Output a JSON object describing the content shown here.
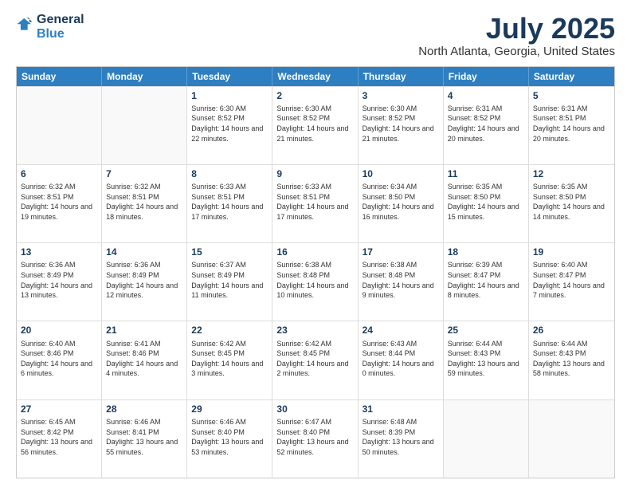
{
  "header": {
    "logo_general": "General",
    "logo_blue": "Blue",
    "month": "July 2025",
    "location": "North Atlanta, Georgia, United States"
  },
  "days_of_week": [
    "Sunday",
    "Monday",
    "Tuesday",
    "Wednesday",
    "Thursday",
    "Friday",
    "Saturday"
  ],
  "weeks": [
    [
      {
        "day": "",
        "sunrise": "",
        "sunset": "",
        "daylight": "",
        "empty": true
      },
      {
        "day": "",
        "sunrise": "",
        "sunset": "",
        "daylight": "",
        "empty": true
      },
      {
        "day": "1",
        "sunrise": "Sunrise: 6:30 AM",
        "sunset": "Sunset: 8:52 PM",
        "daylight": "Daylight: 14 hours and 22 minutes."
      },
      {
        "day": "2",
        "sunrise": "Sunrise: 6:30 AM",
        "sunset": "Sunset: 8:52 PM",
        "daylight": "Daylight: 14 hours and 21 minutes."
      },
      {
        "day": "3",
        "sunrise": "Sunrise: 6:30 AM",
        "sunset": "Sunset: 8:52 PM",
        "daylight": "Daylight: 14 hours and 21 minutes."
      },
      {
        "day": "4",
        "sunrise": "Sunrise: 6:31 AM",
        "sunset": "Sunset: 8:52 PM",
        "daylight": "Daylight: 14 hours and 20 minutes."
      },
      {
        "day": "5",
        "sunrise": "Sunrise: 6:31 AM",
        "sunset": "Sunset: 8:51 PM",
        "daylight": "Daylight: 14 hours and 20 minutes."
      }
    ],
    [
      {
        "day": "6",
        "sunrise": "Sunrise: 6:32 AM",
        "sunset": "Sunset: 8:51 PM",
        "daylight": "Daylight: 14 hours and 19 minutes."
      },
      {
        "day": "7",
        "sunrise": "Sunrise: 6:32 AM",
        "sunset": "Sunset: 8:51 PM",
        "daylight": "Daylight: 14 hours and 18 minutes."
      },
      {
        "day": "8",
        "sunrise": "Sunrise: 6:33 AM",
        "sunset": "Sunset: 8:51 PM",
        "daylight": "Daylight: 14 hours and 17 minutes."
      },
      {
        "day": "9",
        "sunrise": "Sunrise: 6:33 AM",
        "sunset": "Sunset: 8:51 PM",
        "daylight": "Daylight: 14 hours and 17 minutes."
      },
      {
        "day": "10",
        "sunrise": "Sunrise: 6:34 AM",
        "sunset": "Sunset: 8:50 PM",
        "daylight": "Daylight: 14 hours and 16 minutes."
      },
      {
        "day": "11",
        "sunrise": "Sunrise: 6:35 AM",
        "sunset": "Sunset: 8:50 PM",
        "daylight": "Daylight: 14 hours and 15 minutes."
      },
      {
        "day": "12",
        "sunrise": "Sunrise: 6:35 AM",
        "sunset": "Sunset: 8:50 PM",
        "daylight": "Daylight: 14 hours and 14 minutes."
      }
    ],
    [
      {
        "day": "13",
        "sunrise": "Sunrise: 6:36 AM",
        "sunset": "Sunset: 8:49 PM",
        "daylight": "Daylight: 14 hours and 13 minutes."
      },
      {
        "day": "14",
        "sunrise": "Sunrise: 6:36 AM",
        "sunset": "Sunset: 8:49 PM",
        "daylight": "Daylight: 14 hours and 12 minutes."
      },
      {
        "day": "15",
        "sunrise": "Sunrise: 6:37 AM",
        "sunset": "Sunset: 8:49 PM",
        "daylight": "Daylight: 14 hours and 11 minutes."
      },
      {
        "day": "16",
        "sunrise": "Sunrise: 6:38 AM",
        "sunset": "Sunset: 8:48 PM",
        "daylight": "Daylight: 14 hours and 10 minutes."
      },
      {
        "day": "17",
        "sunrise": "Sunrise: 6:38 AM",
        "sunset": "Sunset: 8:48 PM",
        "daylight": "Daylight: 14 hours and 9 minutes."
      },
      {
        "day": "18",
        "sunrise": "Sunrise: 6:39 AM",
        "sunset": "Sunset: 8:47 PM",
        "daylight": "Daylight: 14 hours and 8 minutes."
      },
      {
        "day": "19",
        "sunrise": "Sunrise: 6:40 AM",
        "sunset": "Sunset: 8:47 PM",
        "daylight": "Daylight: 14 hours and 7 minutes."
      }
    ],
    [
      {
        "day": "20",
        "sunrise": "Sunrise: 6:40 AM",
        "sunset": "Sunset: 8:46 PM",
        "daylight": "Daylight: 14 hours and 6 minutes."
      },
      {
        "day": "21",
        "sunrise": "Sunrise: 6:41 AM",
        "sunset": "Sunset: 8:46 PM",
        "daylight": "Daylight: 14 hours and 4 minutes."
      },
      {
        "day": "22",
        "sunrise": "Sunrise: 6:42 AM",
        "sunset": "Sunset: 8:45 PM",
        "daylight": "Daylight: 14 hours and 3 minutes."
      },
      {
        "day": "23",
        "sunrise": "Sunrise: 6:42 AM",
        "sunset": "Sunset: 8:45 PM",
        "daylight": "Daylight: 14 hours and 2 minutes."
      },
      {
        "day": "24",
        "sunrise": "Sunrise: 6:43 AM",
        "sunset": "Sunset: 8:44 PM",
        "daylight": "Daylight: 14 hours and 0 minutes."
      },
      {
        "day": "25",
        "sunrise": "Sunrise: 6:44 AM",
        "sunset": "Sunset: 8:43 PM",
        "daylight": "Daylight: 13 hours and 59 minutes."
      },
      {
        "day": "26",
        "sunrise": "Sunrise: 6:44 AM",
        "sunset": "Sunset: 8:43 PM",
        "daylight": "Daylight: 13 hours and 58 minutes."
      }
    ],
    [
      {
        "day": "27",
        "sunrise": "Sunrise: 6:45 AM",
        "sunset": "Sunset: 8:42 PM",
        "daylight": "Daylight: 13 hours and 56 minutes."
      },
      {
        "day": "28",
        "sunrise": "Sunrise: 6:46 AM",
        "sunset": "Sunset: 8:41 PM",
        "daylight": "Daylight: 13 hours and 55 minutes."
      },
      {
        "day": "29",
        "sunrise": "Sunrise: 6:46 AM",
        "sunset": "Sunset: 8:40 PM",
        "daylight": "Daylight: 13 hours and 53 minutes."
      },
      {
        "day": "30",
        "sunrise": "Sunrise: 6:47 AM",
        "sunset": "Sunset: 8:40 PM",
        "daylight": "Daylight: 13 hours and 52 minutes."
      },
      {
        "day": "31",
        "sunrise": "Sunrise: 6:48 AM",
        "sunset": "Sunset: 8:39 PM",
        "daylight": "Daylight: 13 hours and 50 minutes."
      },
      {
        "day": "",
        "sunrise": "",
        "sunset": "",
        "daylight": "",
        "empty": true
      },
      {
        "day": "",
        "sunrise": "",
        "sunset": "",
        "daylight": "",
        "empty": true
      }
    ]
  ]
}
